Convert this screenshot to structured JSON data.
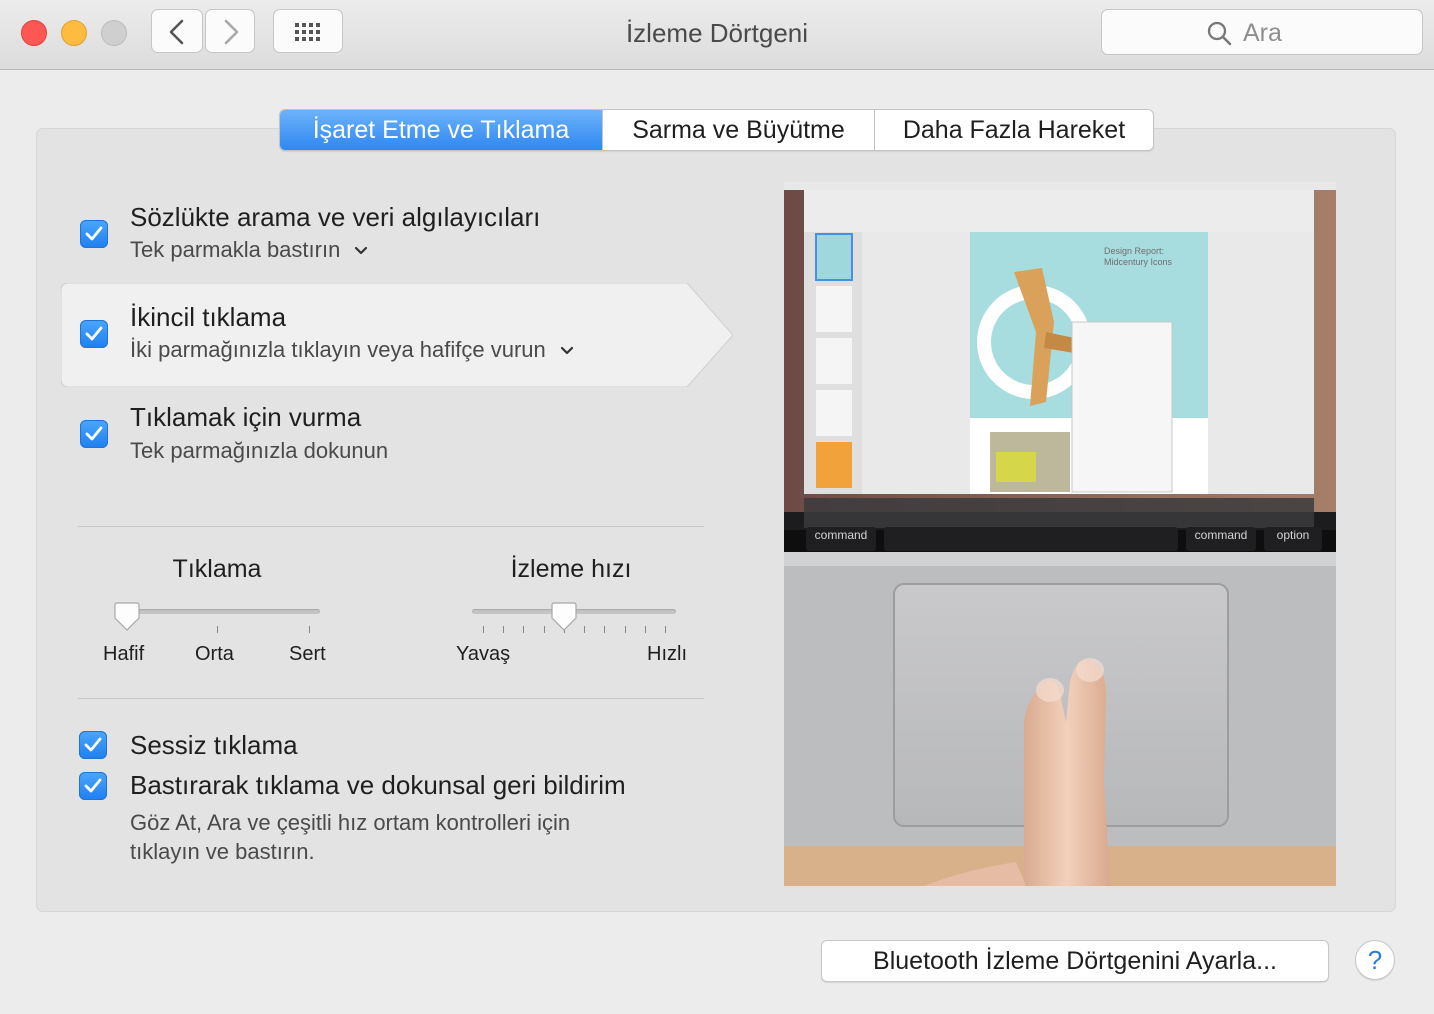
{
  "window": {
    "title": "İzleme Dörtgeni",
    "search_placeholder": "Ara"
  },
  "tabs": [
    {
      "label": "İşaret Etme ve Tıklama",
      "active": true
    },
    {
      "label": "Sarma ve Büyütme",
      "active": false
    },
    {
      "label": "Daha Fazla Hareket",
      "active": false
    }
  ],
  "options": [
    {
      "title": "Sözlükte arama ve veri algılayıcıları",
      "subtitle": "Tek parmakla bastırın",
      "checked": true
    },
    {
      "title": "İkincil tıklama",
      "subtitle": "İki parmağınızla tıklayın veya hafifçe vurun",
      "checked": true
    },
    {
      "title": "Tıklamak için vurma",
      "subtitle": "Tek parmağınızla dokunun",
      "checked": true
    }
  ],
  "click_slider": {
    "label": "Tıklama",
    "ticks": [
      "Hafif",
      "Orta",
      "Sert"
    ],
    "value_index": 0
  },
  "tracking_slider": {
    "label": "İzleme hızı",
    "min_label": "Yavaş",
    "max_label": "Hızlı",
    "value_fraction": 0.45
  },
  "bottom_options": [
    {
      "title": "Sessiz tıklama",
      "checked": true
    },
    {
      "title": "Bastırarak tıklama ve dokunsal geri bildirim",
      "checked": true
    }
  ],
  "force_click_desc_line1": "Göz At, Ara ve çeşitli hız ortam kontrolleri için",
  "force_click_desc_line2": "tıklayın ve bastırın.",
  "preview": {
    "keys": [
      "command",
      "command",
      "option"
    ],
    "doc_title": "Design Report: Midcentury Icons"
  },
  "bluetooth_button": "Bluetooth İzleme Dörtgenini Ayarla...",
  "help_label": "?",
  "colors": {
    "accent": "#2f87f1",
    "close": "#fc5753",
    "minimize": "#fdbc40",
    "zoom_disabled": "#cfcfcf"
  }
}
